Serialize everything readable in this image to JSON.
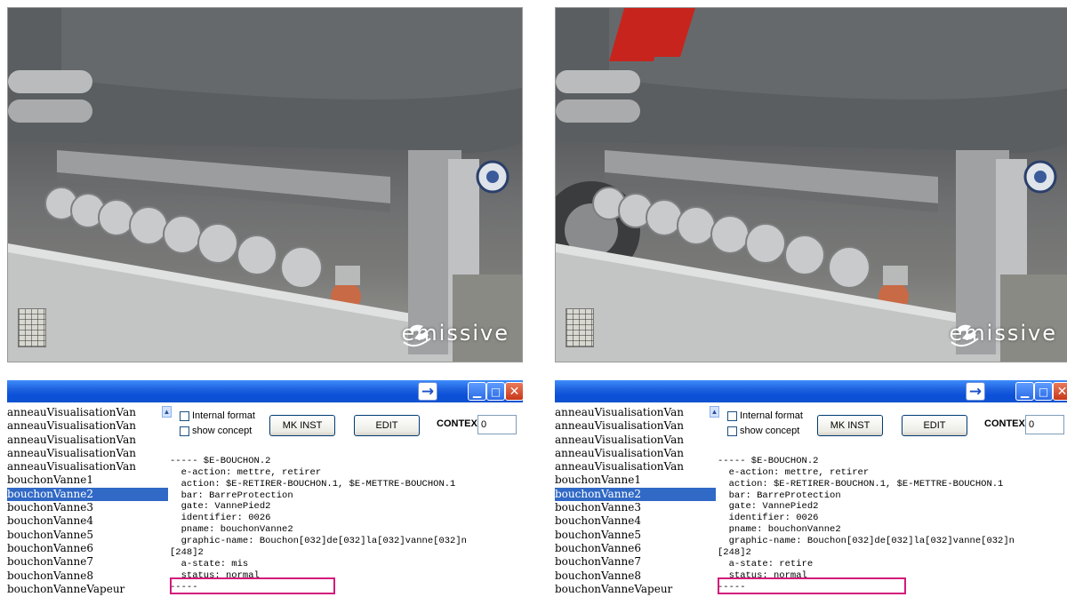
{
  "colors": {
    "titlebar": "#0a4fd8",
    "selection": "#3169c6",
    "highlight": "#d4197b",
    "tanker_stripe": "#c8241e"
  },
  "panels": [
    {
      "id": "left",
      "viewport": {
        "logo_text": "emissive"
      },
      "titlebar_icons": [
        "arrow-right-icon",
        "minimize-icon",
        "maximize-icon",
        "close-icon"
      ],
      "list_items": [
        "anneauVisualisationVan",
        "anneauVisualisationVan",
        "anneauVisualisationVan",
        "anneauVisualisationVan",
        "anneauVisualisationVan",
        "bouchonVanne1",
        "bouchonVanne2",
        "bouchonVanne3",
        "bouchonVanne4",
        "bouchonVanne5",
        "bouchonVanne6",
        "bouchonVanne7",
        "bouchonVanne8",
        "bouchonVanneVapeur"
      ],
      "selected_index": 6,
      "controls": {
        "internal_format": "Internal format",
        "show_concept": "show concept",
        "mk_inst": "MK INST",
        "edit": "EDIT",
        "context_label": "CONTEXT",
        "context_value": "0"
      },
      "text_lines": [
        "",
        "----- $E-BOUCHON.2",
        "  e-action: mettre, retirer",
        "  action: $E-RETIRER-BOUCHON.1, $E-METTRE-BOUCHON.1",
        "  bar: BarreProtection",
        "  gate: VannePied2",
        "  identifier: 0026",
        "  pname: bouchonVanne2",
        "  graphic-name: Bouchon[032]de[032]la[032]vanne[032]n",
        "[248]2",
        "  a-state: mis",
        "  status: normal",
        "-----"
      ]
    },
    {
      "id": "right",
      "viewport": {
        "logo_text": "emissive"
      },
      "titlebar_icons": [
        "arrow-right-icon",
        "minimize-icon",
        "maximize-icon",
        "close-icon"
      ],
      "list_items": [
        "anneauVisualisationVan",
        "anneauVisualisationVan",
        "anneauVisualisationVan",
        "anneauVisualisationVan",
        "anneauVisualisationVan",
        "bouchonVanne1",
        "bouchonVanne2",
        "bouchonVanne3",
        "bouchonVanne4",
        "bouchonVanne5",
        "bouchonVanne6",
        "bouchonVanne7",
        "bouchonVanne8",
        "bouchonVanneVapeur"
      ],
      "selected_index": 6,
      "controls": {
        "internal_format": "Internal format",
        "show_concept": "show concept",
        "mk_inst": "MK INST",
        "edit": "EDIT",
        "context_label": "CONTEXT",
        "context_value": "0"
      },
      "text_lines": [
        "",
        "----- $E-BOUCHON.2",
        "  e-action: mettre, retirer",
        "  action: $E-RETIRER-BOUCHON.1, $E-METTRE-BOUCHON.1",
        "  bar: BarreProtection",
        "  gate: VannePied2",
        "  identifier: 0026",
        "  pname: bouchonVanne2",
        "  graphic-name: Bouchon[032]de[032]la[032]vanne[032]n",
        "[248]2",
        "  a-state: retire",
        "  status: normal",
        "-----"
      ]
    }
  ]
}
